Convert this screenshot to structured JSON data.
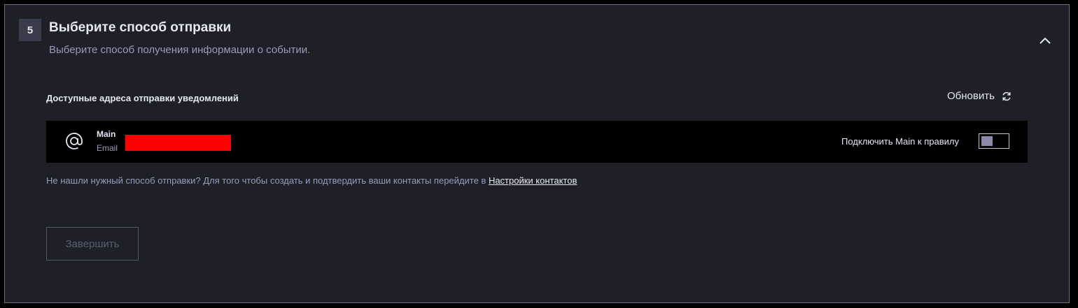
{
  "step": {
    "number": "5",
    "title": "Выберите способ отправки",
    "subtitle": "Выберите способ получения информации о событии."
  },
  "icons": {
    "collapse": "chevron-up-icon",
    "refresh": "refresh-icon",
    "address_type": "at-icon"
  },
  "addresses": {
    "section_label": "Доступные адреса отправки уведомлений",
    "refresh_label": "Обновить",
    "items": [
      {
        "name": "Main",
        "type": "Email",
        "connect_label": "Подключить Main к правилу",
        "connected": false
      }
    ]
  },
  "hint": {
    "text": "Не нашли нужный способ отправки? Для того чтобы создать и подтвердить ваши контакты перейдите в ",
    "link_label": "Настройки контактов"
  },
  "actions": {
    "finish_label": "Завершить",
    "finish_disabled": true
  },
  "colors": {
    "panel_bg": "#1f2027",
    "row_bg": "#000000",
    "text_primary": "#e6e7f2",
    "text_secondary": "#9a9ab8",
    "redaction": "#ff0000"
  }
}
